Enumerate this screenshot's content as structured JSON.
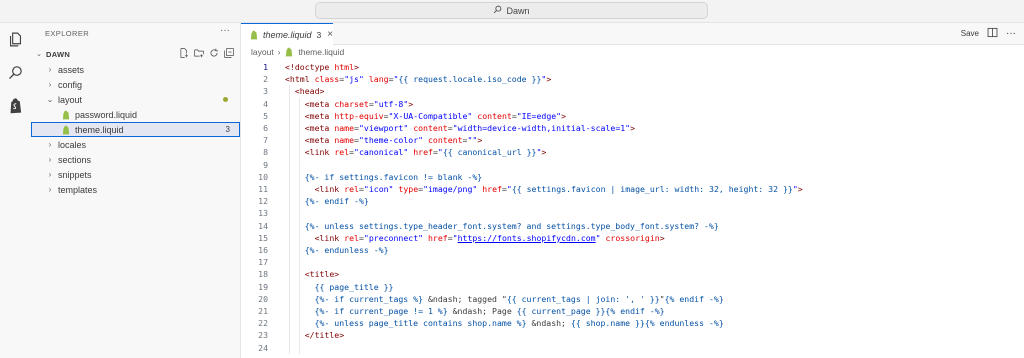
{
  "window": {
    "search_label": "Dawn"
  },
  "activity_bar": {
    "items": [
      "files-icon",
      "search-icon",
      "shopify-icon"
    ]
  },
  "sidebar": {
    "title": "EXPLORER",
    "more": "···",
    "root_label": "DAWN",
    "tree": [
      {
        "label": "assets",
        "type": "folder",
        "expanded": false
      },
      {
        "label": "config",
        "type": "folder",
        "expanded": false
      },
      {
        "label": "layout",
        "type": "folder",
        "expanded": true,
        "modified_dot": true
      },
      {
        "label": "password.liquid",
        "type": "file"
      },
      {
        "label": "theme.liquid",
        "type": "file",
        "selected": true,
        "badge": "3"
      },
      {
        "label": "locales",
        "type": "folder",
        "expanded": false
      },
      {
        "label": "sections",
        "type": "folder",
        "expanded": false
      },
      {
        "label": "snippets",
        "type": "folder",
        "expanded": false
      },
      {
        "label": "templates",
        "type": "folder",
        "expanded": false
      }
    ]
  },
  "editor": {
    "tab": {
      "name": "theme.liquid",
      "count": "3",
      "close": "×"
    },
    "actions": {
      "save_label": "Save",
      "more": "···"
    },
    "breadcrumb": {
      "folder": "layout",
      "file": "theme.liquid"
    },
    "active_line": 1,
    "lines": [
      "<!doctype html>",
      "<html class=\"js\" lang=\"{{ request.locale.iso_code }}\">",
      "  <head>",
      "    <meta charset=\"utf-8\">",
      "    <meta http-equiv=\"X-UA-Compatible\" content=\"IE=edge\">",
      "    <meta name=\"viewport\" content=\"width=device-width,initial-scale=1\">",
      "    <meta name=\"theme-color\" content=\"\">",
      "    <link rel=\"canonical\" href=\"{{ canonical_url }}\">",
      "",
      "    {%- if settings.favicon != blank -%}",
      "      <link rel=\"icon\" type=\"image/png\" href=\"{{ settings.favicon | image_url: width: 32, height: 32 }}\">",
      "    {%- endif -%}",
      "",
      "    {%- unless settings.type_header_font.system? and settings.type_body_font.system? -%}",
      "      <link rel=\"preconnect\" href=\"https://fonts.shopifycdn.com\" crossorigin>",
      "    {%- endunless -%}",
      "",
      "    <title>",
      "      {{ page_title }}",
      "      {%- if current_tags %} &ndash; tagged \"{{ current_tags | join: ', ' }}\"{% endif -%}",
      "      {%- if current_page != 1 %} &ndash; Page {{ current_page }}{% endif -%}",
      "      {%- unless page_title contains shop.name %} &ndash; {{ shop.name }}{% endunless -%}",
      "    </title>",
      ""
    ]
  },
  "colors": {
    "accent": "#0969da",
    "tag": "#800000",
    "attribute": "#e50000",
    "string": "#0000ff",
    "liquid": "#0451a5"
  }
}
